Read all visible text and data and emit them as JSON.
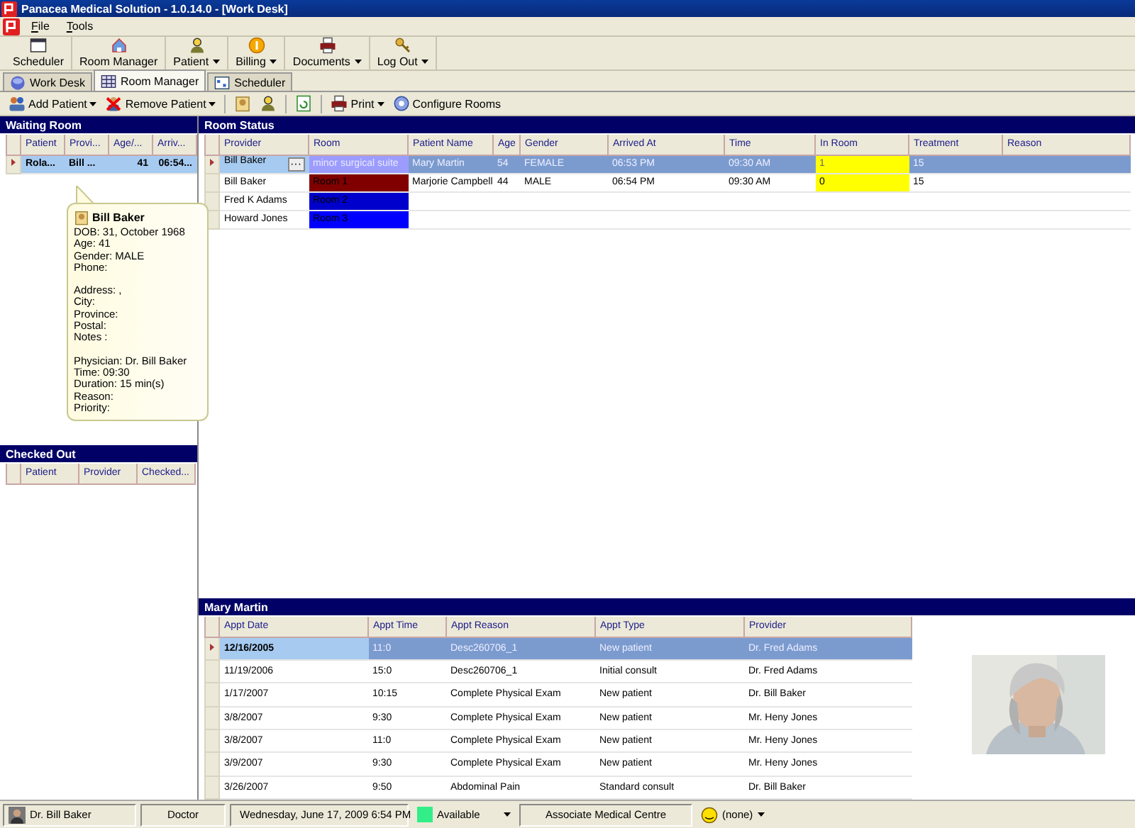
{
  "window": {
    "title": "Panacea Medical Solution - 1.0.14.0 - [Work Desk]"
  },
  "menu": [
    "File",
    "Tools"
  ],
  "toolbar": [
    {
      "label": "Scheduler",
      "dropdown": false
    },
    {
      "label": "Room Manager",
      "dropdown": false
    },
    {
      "label": "Patient",
      "dropdown": true
    },
    {
      "label": "Billing",
      "dropdown": true
    },
    {
      "label": "Documents",
      "dropdown": true
    },
    {
      "label": "Log Out",
      "dropdown": true
    }
  ],
  "tabs": [
    {
      "label": "Work Desk",
      "selected": false
    },
    {
      "label": "Room Manager",
      "selected": true
    },
    {
      "label": "Scheduler",
      "selected": false
    }
  ],
  "actions": [
    {
      "label": "Add Patient",
      "dropdown": true
    },
    {
      "label": "Remove Patient",
      "dropdown": true
    },
    {
      "label": "Print",
      "dropdown": true
    },
    {
      "label": "Configure Rooms",
      "dropdown": false
    }
  ],
  "waiting_room": {
    "title": "Waiting Room",
    "columns": [
      "Patient",
      "Provi...",
      "Age/...",
      "Arriv..."
    ],
    "rows": [
      {
        "cells": [
          "Rola...",
          "Bill    ...",
          "41",
          "06:54..."
        ],
        "selected": true
      }
    ]
  },
  "tooltip": {
    "name": "Bill   Baker",
    "groups": [
      [
        "DOB: 31, October 1968",
        "Age: 41",
        "Gender: MALE",
        "Phone:"
      ],
      [
        "Address: ,",
        "City:",
        "Province:",
        "Postal:",
        "Notes :"
      ],
      [
        "Physician: Dr. Bill  Baker",
        "Time: 09:30",
        "Duration: 15 min(s)",
        "Reason:",
        "Priority:"
      ]
    ]
  },
  "checked_out": {
    "title": "Checked Out",
    "columns": [
      "Patient",
      "Provider",
      "Checked..."
    ]
  },
  "room_status": {
    "title": "Room Status",
    "columns": [
      "Provider",
      "Room",
      "Patient Name",
      "Age",
      "Gender",
      "Arrived At",
      "Time",
      "In Room",
      "Treatment",
      "Reason"
    ],
    "rows": [
      {
        "provider": "Bill  Baker",
        "more": "···",
        "room": {
          "label": "minor surgical suite",
          "color": "#9c9cff"
        },
        "patient": "Mary  Martin",
        "age": "54",
        "gender": "FEMALE",
        "arrived": "06:53 PM",
        "time": "09:30 AM",
        "in_room": {
          "text": "1",
          "color": "#ffff00"
        },
        "treatment": "15",
        "selected": true
      },
      {
        "provider": "Bill  Baker",
        "room": {
          "label": "Room 1",
          "color": "#800000"
        },
        "patient": "Marjorie  Campbell",
        "age": "44",
        "gender": "MALE",
        "arrived": "06:54 PM",
        "time": "09:30 AM",
        "in_room": {
          "text": "0",
          "color": "#ffff00"
        },
        "treatment": "15",
        "selected": false
      },
      {
        "provider": "Fred  K Adams",
        "room": {
          "label": "Room 2",
          "color": "#0000cc"
        },
        "selected": false
      },
      {
        "provider": "Howard  Jones",
        "room": {
          "label": "Room 3",
          "color": "#0000ff"
        },
        "selected": false
      }
    ]
  },
  "appointments": {
    "title": "Mary  Martin",
    "columns": [
      "Appt Date",
      "Appt Time",
      "Appt Reason",
      "Appt Type",
      "Provider"
    ],
    "rows": [
      {
        "cells": [
          "12/16/2005",
          "11:0",
          "Desc260706_1",
          "New patient",
          "Dr. Fred Adams"
        ],
        "selected": true
      },
      {
        "cells": [
          "11/19/2006",
          "15:0",
          "Desc260706_1",
          "Initial consult",
          "Dr. Fred Adams"
        ],
        "selected": false
      },
      {
        "cells": [
          "1/17/2007",
          "10:15",
          "Complete Physical Exam",
          "New patient",
          "Dr. Bill  Baker"
        ],
        "selected": false
      },
      {
        "cells": [
          "3/8/2007",
          "9:30",
          "Complete Physical Exam",
          "New patient",
          "Mr. Heny Jones"
        ],
        "selected": false
      },
      {
        "cells": [
          "3/8/2007",
          "11:0",
          "Complete Physical Exam",
          "New patient",
          "Mr. Heny Jones"
        ],
        "selected": false
      },
      {
        "cells": [
          "3/9/2007",
          "9:30",
          "Complete Physical Exam",
          "New patient",
          "Mr. Heny Jones"
        ],
        "selected": false
      },
      {
        "cells": [
          "3/26/2007",
          "9:50",
          "Abdominal Pain",
          "Standard consult",
          "Dr. Bill  Baker"
        ],
        "selected": false
      }
    ]
  },
  "status_bar": {
    "user": "Dr. Bill  Baker",
    "role": "Doctor",
    "datetime": "Wednesday, June 17, 2009 6:54 PM",
    "availability": {
      "label": "Available",
      "color": "#33ee88"
    },
    "location": "Associate Medical Centre",
    "mood": "(none)"
  }
}
